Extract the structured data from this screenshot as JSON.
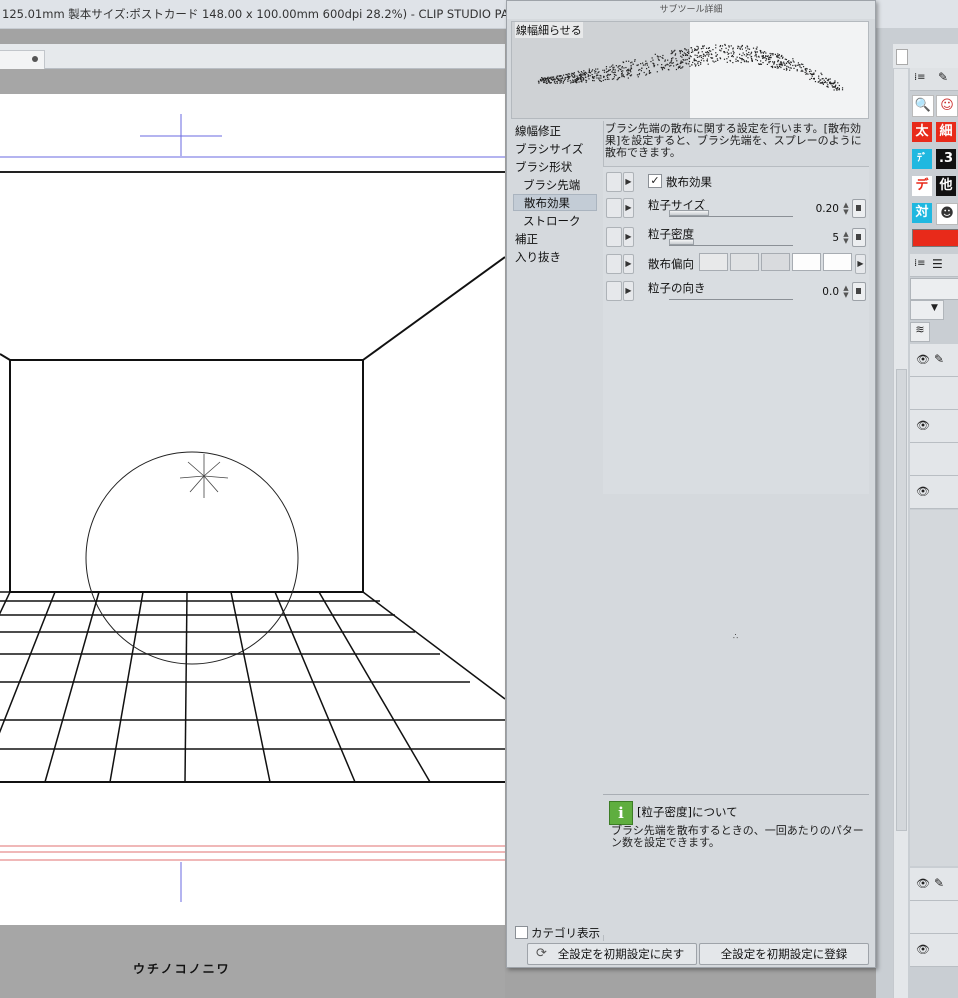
{
  "titlebar": {
    "text": "125.01mm 製本サイズ:ポストカード 148.00 x 100.00mm 600dpi 28.2%)  - CLIP STUDIO PAINT EX"
  },
  "canvas": {
    "caption": "ウチノコノニワ"
  },
  "panel": {
    "title": "サブツール詳細",
    "preview_label": "線幅細らせる",
    "categories": [
      "線幅修正",
      "ブラシサイズ",
      "ブラシ形状",
      "ブラシ先端",
      "散布効果",
      "ストローク",
      "補正",
      "入り抜き"
    ],
    "selected_category": "散布効果",
    "description": "ブラシ先端の散布に関する設定を行います。[散布効果]を設定すると、ブラシ先端を、スプレーのように散布できます。",
    "settings": {
      "scatter_effect": {
        "label": "散布効果",
        "checked": true
      },
      "particle_size": {
        "label": "粒子サイズ",
        "value": "0.20"
      },
      "particle_density": {
        "label": "粒子密度",
        "value": "5"
      },
      "scatter_bias": {
        "label": "散布偏向"
      },
      "particle_direction": {
        "label": "粒子の向き",
        "value": "0.0"
      }
    },
    "info": {
      "title": "[粒子密度]について",
      "body": "ブラシ先端を散布するときの、一回あたりのパターン数を設定できます。"
    },
    "category_display": "カテゴリ表示",
    "reset_button": "全設定を初期設定に戻す",
    "register_button": "全設定を初期設定に登録"
  },
  "right_panel": {
    "icons": [
      "太",
      "細",
      "デ",
      "他",
      "対",
      ".3"
    ],
    "colors": {
      "red": "#e82a1a",
      "cyan": "#1fb8e0"
    }
  }
}
